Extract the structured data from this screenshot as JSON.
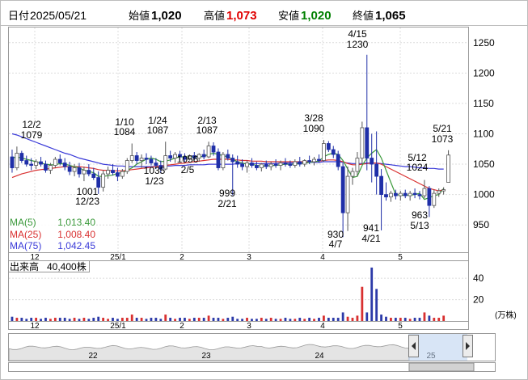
{
  "header": {
    "date_label": "日付",
    "date": "2025/05/21",
    "open_label": "始値",
    "open": "1,020",
    "high_label": "高値",
    "high": "1,073",
    "low_label": "安値",
    "low": "1,020",
    "close_label": "終値",
    "close": "1,065"
  },
  "colors": {
    "up": "#ffffff",
    "down": "#1f2fa8",
    "high_text": "#e00000",
    "low_text": "#008000",
    "ma5": "#3c9a3c",
    "ma25": "#d93030",
    "ma75": "#3a3ad8",
    "vol_up": "#d83030",
    "vol_down": "#2c3aa8"
  },
  "chart_data": [
    {
      "type": "candlestick",
      "y_ticks": [
        950,
        1000,
        1050,
        1100,
        1150,
        1200,
        1250
      ],
      "ylim": [
        905,
        1275
      ],
      "x_tick_labels": [
        "12",
        "25/1",
        "2",
        "3",
        "4",
        "5"
      ],
      "legend": [
        {
          "label": "MA(5)",
          "value": "1,013.40"
        },
        {
          "label": "MA(25)",
          "value": "1,008.40"
        },
        {
          "label": "MA(75)",
          "value": "1,042.45"
        }
      ],
      "annotations": [
        {
          "date": "12/2",
          "value": "1079",
          "kind": "high"
        },
        {
          "date": "12/23",
          "value": "1001",
          "kind": "low"
        },
        {
          "date": "1/10",
          "value": "1084",
          "kind": "high"
        },
        {
          "date": "1/23",
          "value": "1035",
          "kind": "low"
        },
        {
          "date": "1/24",
          "value": "1087",
          "kind": "high"
        },
        {
          "date": "2/5",
          "value": "1056",
          "kind": "low"
        },
        {
          "date": "2/13",
          "value": "1087",
          "kind": "high"
        },
        {
          "date": "2/21",
          "value": "999",
          "kind": "low"
        },
        {
          "date": "3/28",
          "value": "1090",
          "kind": "high"
        },
        {
          "date": "4/7",
          "value": "930",
          "kind": "low"
        },
        {
          "date": "4/15",
          "value": "1230",
          "kind": "high"
        },
        {
          "date": "4/21",
          "value": "941",
          "kind": "low"
        },
        {
          "date": "5/12",
          "value": "1024",
          "kind": "high"
        },
        {
          "date": "5/13",
          "value": "963",
          "kind": "low"
        },
        {
          "date": "5/21",
          "value": "1073",
          "kind": "high"
        }
      ],
      "ohlc": [
        [
          1062,
          1074,
          1036,
          1044
        ],
        [
          1044,
          1079,
          1040,
          1068
        ],
        [
          1068,
          1072,
          1052,
          1056
        ],
        [
          1056,
          1064,
          1046,
          1050
        ],
        [
          1050,
          1060,
          1040,
          1048
        ],
        [
          1048,
          1058,
          1042,
          1054
        ],
        [
          1054,
          1062,
          1046,
          1050
        ],
        [
          1050,
          1056,
          1036,
          1040
        ],
        [
          1040,
          1052,
          1034,
          1048
        ],
        [
          1048,
          1062,
          1044,
          1058
        ],
        [
          1058,
          1066,
          1048,
          1052
        ],
        [
          1052,
          1060,
          1040,
          1046
        ],
        [
          1046,
          1054,
          1032,
          1038
        ],
        [
          1038,
          1050,
          1030,
          1044
        ],
        [
          1044,
          1052,
          1028,
          1034
        ],
        [
          1034,
          1046,
          1022,
          1040
        ],
        [
          1040,
          1050,
          1030,
          1034
        ],
        [
          1034,
          1044,
          1024,
          1028
        ],
        [
          1028,
          1038,
          1001,
          1012
        ],
        [
          1012,
          1040,
          1005,
          1034
        ],
        [
          1034,
          1046,
          1026,
          1040
        ],
        [
          1040,
          1050,
          1032,
          1036
        ],
        [
          1036,
          1044,
          1022,
          1030
        ],
        [
          1030,
          1042,
          1026,
          1038
        ],
        [
          1038,
          1060,
          1034,
          1056
        ],
        [
          1056,
          1084,
          1052,
          1064
        ],
        [
          1064,
          1070,
          1050,
          1056
        ],
        [
          1056,
          1066,
          1044,
          1060
        ],
        [
          1060,
          1068,
          1050,
          1058
        ],
        [
          1058,
          1064,
          1048,
          1052
        ],
        [
          1052,
          1060,
          1042,
          1048
        ],
        [
          1048,
          1056,
          1035,
          1042
        ],
        [
          1042,
          1087,
          1040,
          1064
        ],
        [
          1064,
          1072,
          1054,
          1060
        ],
        [
          1060,
          1070,
          1052,
          1066
        ],
        [
          1066,
          1072,
          1056,
          1062
        ],
        [
          1062,
          1068,
          1054,
          1058
        ],
        [
          1058,
          1066,
          1056,
          1064
        ],
        [
          1064,
          1070,
          1056,
          1060
        ],
        [
          1060,
          1068,
          1054,
          1066
        ],
        [
          1066,
          1074,
          1058,
          1062
        ],
        [
          1062,
          1087,
          1060,
          1080
        ],
        [
          1080,
          1086,
          1064,
          1070
        ],
        [
          1070,
          1076,
          1040,
          1044
        ],
        [
          1044,
          1070,
          1040,
          1066
        ],
        [
          1066,
          1074,
          1056,
          1060
        ],
        [
          1060,
          1066,
          999,
          1054
        ],
        [
          1054,
          1064,
          1044,
          1050
        ],
        [
          1050,
          1058,
          1040,
          1046
        ],
        [
          1046,
          1056,
          1036,
          1052
        ],
        [
          1052,
          1060,
          1044,
          1048
        ],
        [
          1048,
          1054,
          1040,
          1044
        ],
        [
          1044,
          1052,
          1038,
          1050
        ],
        [
          1050,
          1056,
          1042,
          1046
        ],
        [
          1046,
          1054,
          1040,
          1050
        ],
        [
          1050,
          1058,
          1044,
          1048
        ],
        [
          1048,
          1056,
          1040,
          1052
        ],
        [
          1052,
          1060,
          1046,
          1050
        ],
        [
          1050,
          1056,
          1044,
          1048
        ],
        [
          1048,
          1058,
          1044,
          1054
        ],
        [
          1054,
          1062,
          1046,
          1050
        ],
        [
          1050,
          1058,
          1046,
          1056
        ],
        [
          1056,
          1064,
          1050,
          1054
        ],
        [
          1054,
          1062,
          1048,
          1058
        ],
        [
          1058,
          1066,
          1052,
          1056
        ],
        [
          1056,
          1090,
          1054,
          1084
        ],
        [
          1084,
          1088,
          1070,
          1074
        ],
        [
          1074,
          1080,
          1060,
          1066
        ],
        [
          1066,
          1072,
          1040,
          1046
        ],
        [
          1046,
          1052,
          930,
          970
        ],
        [
          970,
          1046,
          940,
          1030
        ],
        [
          1030,
          1044,
          1016,
          1038
        ],
        [
          1038,
          1070,
          1030,
          1060
        ],
        [
          1060,
          1120,
          1050,
          1110
        ],
        [
          1110,
          1230,
          1040,
          1060
        ],
        [
          1060,
          1100,
          1020,
          1050
        ],
        [
          1050,
          1104,
          1000,
          1030
        ],
        [
          1030,
          1042,
          941,
          1000
        ],
        [
          1000,
          1020,
          990,
          996
        ],
        [
          996,
          1006,
          988,
          1002
        ],
        [
          1002,
          1008,
          992,
          998
        ],
        [
          998,
          1006,
          990,
          1002
        ],
        [
          1002,
          1008,
          994,
          998
        ],
        [
          998,
          1006,
          990,
          1002
        ],
        [
          1002,
          1010,
          994,
          1000
        ],
        [
          1000,
          1006,
          992,
          998
        ],
        [
          998,
          1024,
          994,
          1010
        ],
        [
          1010,
          1014,
          963,
          982
        ],
        [
          982,
          1008,
          978,
          1002
        ],
        [
          1002,
          1010,
          996,
          1006
        ],
        [
          1006,
          1012,
          1000,
          1008
        ],
        [
          1020,
          1073,
          1020,
          1065
        ]
      ],
      "ma5": [
        1060,
        1062,
        1060,
        1058,
        1056,
        1054,
        1052,
        1050,
        1049,
        1049,
        1051,
        1050,
        1048,
        1046,
        1044,
        1040,
        1038,
        1036,
        1030,
        1030,
        1031,
        1032,
        1035,
        1036,
        1040,
        1044,
        1050,
        1054,
        1058,
        1060,
        1058,
        1054,
        1055,
        1057,
        1060,
        1062,
        1062,
        1062,
        1062,
        1062,
        1063,
        1066,
        1068,
        1066,
        1064,
        1062,
        1058,
        1054,
        1052,
        1050,
        1050,
        1048,
        1047,
        1047,
        1048,
        1048,
        1049,
        1050,
        1050,
        1050,
        1051,
        1052,
        1053,
        1054,
        1055,
        1062,
        1066,
        1068,
        1066,
        1056,
        1042,
        1028,
        1030,
        1048,
        1060,
        1068,
        1074,
        1060,
        1040,
        1020,
        1000,
        999,
        999,
        999,
        1000,
        1002,
        992,
        995,
        998,
        1000,
        1010
      ],
      "ma25": [
        1028,
        1031,
        1034,
        1036,
        1038,
        1040,
        1041,
        1042,
        1043,
        1044,
        1045,
        1046,
        1046,
        1046,
        1046,
        1045,
        1044,
        1043,
        1041,
        1040,
        1040,
        1039,
        1039,
        1039,
        1040,
        1041,
        1042,
        1043,
        1044,
        1045,
        1046,
        1047,
        1048,
        1049,
        1050,
        1051,
        1052,
        1053,
        1054,
        1055,
        1056,
        1057,
        1058,
        1058,
        1058,
        1058,
        1057,
        1057,
        1056,
        1056,
        1055,
        1055,
        1055,
        1054,
        1054,
        1054,
        1054,
        1054,
        1054,
        1054,
        1054,
        1054,
        1054,
        1054,
        1055,
        1056,
        1057,
        1057,
        1056,
        1054,
        1051,
        1049,
        1049,
        1050,
        1051,
        1052,
        1052,
        1050,
        1046,
        1042,
        1038,
        1034,
        1030,
        1026,
        1022,
        1018,
        1014,
        1010,
        1008,
        1006,
        1008
      ],
      "ma75": [
        1100,
        1098,
        1095,
        1092,
        1089,
        1086,
        1083,
        1080,
        1077,
        1074,
        1071,
        1068,
        1066,
        1063,
        1060,
        1058,
        1056,
        1054,
        1052,
        1050,
        1049,
        1048,
        1047,
        1047,
        1046,
        1046,
        1046,
        1046,
        1046,
        1046,
        1046,
        1047,
        1047,
        1047,
        1048,
        1048,
        1048,
        1049,
        1049,
        1049,
        1049,
        1050,
        1050,
        1050,
        1050,
        1050,
        1050,
        1051,
        1051,
        1051,
        1051,
        1051,
        1051,
        1051,
        1051,
        1051,
        1052,
        1052,
        1052,
        1052,
        1052,
        1052,
        1053,
        1053,
        1053,
        1054,
        1054,
        1054,
        1054,
        1053,
        1052,
        1051,
        1051,
        1051,
        1052,
        1052,
        1052,
        1051,
        1050,
        1049,
        1048,
        1047,
        1046,
        1046,
        1045,
        1044,
        1044,
        1043,
        1043,
        1042,
        1042
      ]
    },
    {
      "type": "bar",
      "title": "出来高",
      "latest": "40,400株",
      "unit": "(万株)",
      "y_ticks": [
        20,
        40
      ],
      "ylim": [
        0,
        56
      ],
      "values": [
        4,
        3,
        3,
        2,
        3,
        3,
        2,
        3,
        2,
        3,
        3,
        3,
        2,
        3,
        2,
        3,
        2,
        3,
        4,
        3,
        2,
        3,
        2,
        3,
        3,
        6,
        3,
        3,
        2,
        3,
        3,
        2,
        6,
        3,
        2,
        3,
        3,
        2,
        3,
        3,
        3,
        5,
        3,
        3,
        2,
        3,
        4,
        2,
        2,
        3,
        2,
        2,
        3,
        2,
        3,
        2,
        2,
        3,
        2,
        2,
        3,
        2,
        3,
        2,
        3,
        5,
        3,
        3,
        3,
        8,
        4,
        3,
        5,
        32,
        8,
        50,
        30,
        6,
        4,
        3,
        3,
        3,
        3,
        2,
        3,
        3,
        8,
        5,
        3,
        3,
        5
      ]
    },
    {
      "type": "area",
      "title": "navigator",
      "x_tick_labels": [
        "22",
        "23",
        "24",
        "25"
      ]
    }
  ]
}
